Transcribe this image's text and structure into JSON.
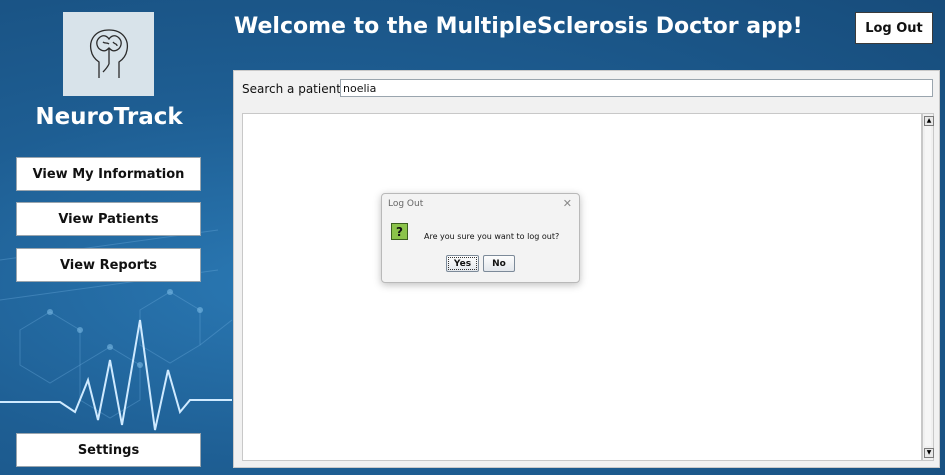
{
  "app": {
    "brand": "NeuroTrack",
    "header_title": "Welcome to the MultipleSclerosis Doctor app!",
    "logout_label": "Log Out"
  },
  "sidebar": {
    "items": [
      {
        "label": "View My Information"
      },
      {
        "label": "View Patients"
      },
      {
        "label": "View Reports"
      }
    ],
    "settings_label": "Settings"
  },
  "search": {
    "label": "Search a patient:",
    "value": "noelia"
  },
  "dialog": {
    "title": "Log Out",
    "close_glyph": "✕",
    "icon": "question-icon",
    "icon_glyph": "?",
    "message": "Are you sure you want to log out?",
    "yes_label": "Yes",
    "no_label": "No"
  },
  "colors": {
    "background": "#1f5f92",
    "panel": "#f1f1f1",
    "question_icon": "#8bc34a"
  }
}
